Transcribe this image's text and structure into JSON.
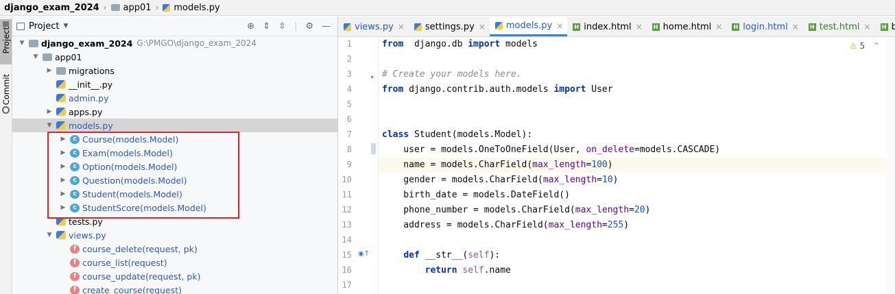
{
  "breadcrumb": {
    "project": "django_exam_2024",
    "folder": "app01",
    "file": "models.py"
  },
  "left_strip": {
    "project_tab": "Project",
    "commit_tab": "Commit"
  },
  "project_panel": {
    "title": "Project",
    "root": {
      "name": "django_exam_2024",
      "path": "G:\\PMGO\\django_exam_2024"
    },
    "tree": [
      {
        "label": "app01",
        "type": "folder",
        "depth": 1,
        "expanded": true
      },
      {
        "label": "migrations",
        "type": "folder",
        "depth": 2,
        "expanded": false
      },
      {
        "label": "__init__.py",
        "type": "py",
        "depth": 2
      },
      {
        "label": "admin.py",
        "type": "py",
        "depth": 2,
        "blue": true
      },
      {
        "label": "apps.py",
        "type": "py",
        "depth": 2,
        "expanded": false
      },
      {
        "label": "models.py",
        "type": "py",
        "depth": 2,
        "expanded": true,
        "blue": true,
        "selected": true
      },
      {
        "label": "Course(models.Model)",
        "type": "class",
        "depth": 3,
        "blue": true
      },
      {
        "label": "Exam(models.Model)",
        "type": "class",
        "depth": 3,
        "blue": true
      },
      {
        "label": "Option(models.Model)",
        "type": "class",
        "depth": 3,
        "blue": true
      },
      {
        "label": "Question(models.Model)",
        "type": "class",
        "depth": 3,
        "blue": true
      },
      {
        "label": "Student(models.Model)",
        "type": "class",
        "depth": 3,
        "blue": true
      },
      {
        "label": "StudentScore(models.Model)",
        "type": "class",
        "depth": 3,
        "blue": true
      },
      {
        "label": "tests.py",
        "type": "py",
        "depth": 2
      },
      {
        "label": "views.py",
        "type": "py",
        "depth": 2,
        "expanded": true,
        "blue": true
      },
      {
        "label": "course_delete(request, pk)",
        "type": "func",
        "depth": 3,
        "blue": true
      },
      {
        "label": "course_list(request)",
        "type": "func",
        "depth": 3,
        "blue": true
      },
      {
        "label": "course_update(request, pk)",
        "type": "func",
        "depth": 3,
        "blue": true
      },
      {
        "label": "create_course(request)",
        "type": "func",
        "depth": 3,
        "blue": true
      }
    ]
  },
  "editor": {
    "tabs": [
      {
        "label": "views.py",
        "type": "py",
        "style": "link"
      },
      {
        "label": "settings.py",
        "type": "py",
        "style": "normal"
      },
      {
        "label": "models.py",
        "type": "py",
        "style": "link",
        "active": true
      },
      {
        "label": "index.html",
        "type": "html",
        "style": "normal"
      },
      {
        "label": "home.html",
        "type": "html",
        "style": "normal"
      },
      {
        "label": "login.html",
        "type": "html",
        "style": "link"
      },
      {
        "label": "test.html",
        "type": "html",
        "style": "mod"
      },
      {
        "label": "base.",
        "type": "html",
        "style": "normal"
      }
    ],
    "warnings_count": "5",
    "current_line": 9,
    "lines": [
      {
        "n": "1",
        "tokens": [
          [
            "kw",
            "from"
          ],
          [
            "",
            "  django.db "
          ],
          [
            "kw",
            "import"
          ],
          [
            "",
            " models"
          ]
        ]
      },
      {
        "n": "2",
        "tokens": []
      },
      {
        "n": "3",
        "tokens": [
          [
            "cm",
            "# Create your models here."
          ]
        ]
      },
      {
        "n": "4",
        "tokens": [
          [
            "kw",
            "from"
          ],
          [
            "",
            " django.contrib.auth.models "
          ],
          [
            "kw",
            "import"
          ],
          [
            "",
            " User"
          ]
        ]
      },
      {
        "n": "5",
        "tokens": []
      },
      {
        "n": "6",
        "tokens": []
      },
      {
        "n": "7",
        "tokens": [
          [
            "kw",
            "class"
          ],
          [
            "",
            " Student(models.Model):"
          ]
        ]
      },
      {
        "n": "8",
        "tokens": [
          [
            "",
            "    user = models.OneToOneField(User, "
          ],
          [
            "kwarg",
            "on_delete"
          ],
          [
            "",
            "=models.CASCADE)"
          ]
        ]
      },
      {
        "n": "9",
        "tokens": [
          [
            "",
            "    name = models.CharField("
          ],
          [
            "kwarg",
            "max_length"
          ],
          [
            "",
            "="
          ],
          [
            "num",
            "100"
          ],
          [
            "",
            ")"
          ]
        ]
      },
      {
        "n": "10",
        "tokens": [
          [
            "",
            "    gender = models.CharField("
          ],
          [
            "kwarg",
            "max_length"
          ],
          [
            "",
            "="
          ],
          [
            "num",
            "10"
          ],
          [
            "",
            ")"
          ]
        ]
      },
      {
        "n": "11",
        "tokens": [
          [
            "",
            "    birth_date = models.DateField()"
          ]
        ]
      },
      {
        "n": "12",
        "tokens": [
          [
            "",
            "    phone_number = models.CharField("
          ],
          [
            "kwarg",
            "max_length"
          ],
          [
            "",
            "="
          ],
          [
            "num",
            "20"
          ],
          [
            "",
            ")"
          ]
        ]
      },
      {
        "n": "13",
        "tokens": [
          [
            "",
            "    address = models.CharField("
          ],
          [
            "kwarg",
            "max_length"
          ],
          [
            "",
            "="
          ],
          [
            "num",
            "255"
          ],
          [
            "",
            ")"
          ]
        ]
      },
      {
        "n": "14",
        "tokens": []
      },
      {
        "n": "15",
        "tokens": [
          [
            "",
            "    "
          ],
          [
            "kw",
            "def"
          ],
          [
            "",
            " __str__("
          ],
          [
            "self",
            "self"
          ],
          [
            "",
            "):"
          ]
        ]
      },
      {
        "n": "16",
        "tokens": [
          [
            "",
            "        "
          ],
          [
            "kw",
            "return"
          ],
          [
            "",
            " "
          ],
          [
            "self",
            "self"
          ],
          [
            "",
            ".name"
          ]
        ]
      },
      {
        "n": "17",
        "tokens": []
      }
    ]
  },
  "colors": {
    "accent": "#4083c9",
    "highlight_box": "#d9262c",
    "keyword": "#0033b3",
    "link_text": "#2a59c9"
  }
}
